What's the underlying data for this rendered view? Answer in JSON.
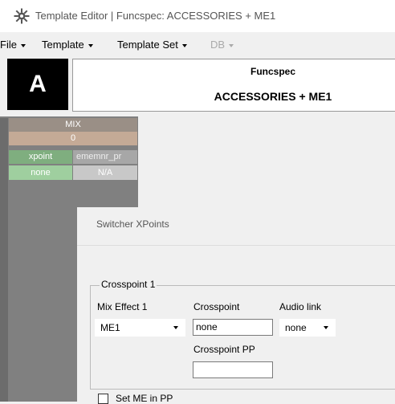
{
  "window": {
    "title": "Template Editor | Funcspec: ACCESSORIES + ME1"
  },
  "menu": [
    {
      "label": "File",
      "enabled": true
    },
    {
      "label": "Template",
      "enabled": true
    },
    {
      "label": "Template Set",
      "enabled": true
    },
    {
      "label": "DB",
      "enabled": false
    }
  ],
  "header": {
    "logo": "A",
    "line1": "Funcspec",
    "line2": "ACCESSORIES + ME1"
  },
  "grid": {
    "col_header": "MIX",
    "col_index": "0",
    "row_label": "xpoint",
    "row_value": "ememnr_pr",
    "row2_label": "none",
    "row2_value": "N/A"
  },
  "dialog": {
    "title": "Switcher XPoints",
    "group": "Crosspoint 1",
    "mix_effect_label": "Mix Effect 1",
    "mix_effect_value": "ME1",
    "crosspoint_label": "Crosspoint",
    "crosspoint_value": "none",
    "audio_label": "Audio link",
    "audio_value": "none",
    "crosspoint_pp_label": "Crosspoint PP",
    "crosspoint_pp_value": "",
    "set_me_label": "Set ME in PP"
  },
  "colors": {
    "mix_header": "#9a8f86",
    "index": "#c4aa96",
    "xpoint": "#7fae7f",
    "none": "#9fcf9f"
  }
}
